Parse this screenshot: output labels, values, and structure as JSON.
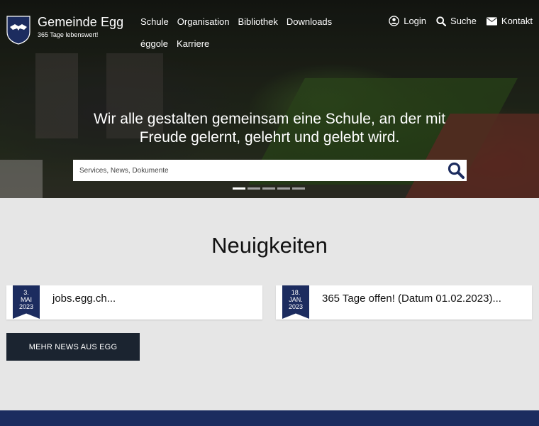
{
  "header": {
    "logo_title": "Gemeinde Egg",
    "logo_subtitle": "365 Tage lebenswert!",
    "nav": [
      "Schule",
      "Organisation",
      "Bibliothek",
      "Downloads",
      "éggole",
      "Karriere"
    ],
    "util": [
      {
        "label": "Login",
        "icon": "user-circle-icon"
      },
      {
        "label": "Suche",
        "icon": "search-icon"
      },
      {
        "label": "Kontakt",
        "icon": "envelope-icon"
      }
    ]
  },
  "hero": {
    "tagline_line1": "Wir alle gestalten gemeinsam eine Schule, an der mit",
    "tagline_line2": "Freude gelernt, gelehrt und gelebt wird.",
    "search_placeholder": "Services, News, Dokumente",
    "slides": 5,
    "active_slide": 1
  },
  "news": {
    "heading": "Neuigkeiten",
    "items": [
      {
        "day": "3.",
        "month": "MAI",
        "year": "2023",
        "title": "jobs.egg.ch..."
      },
      {
        "day": "18.",
        "month": "JAN.",
        "year": "2023",
        "title": "365 Tage offen! (Datum 01.02.2023)..."
      }
    ],
    "more_label": "MEHR NEWS AUS EGG"
  },
  "colors": {
    "brand_navy": "#1c2c5f",
    "button_dark": "#1b2430",
    "page_bg": "#e6e6e6"
  }
}
